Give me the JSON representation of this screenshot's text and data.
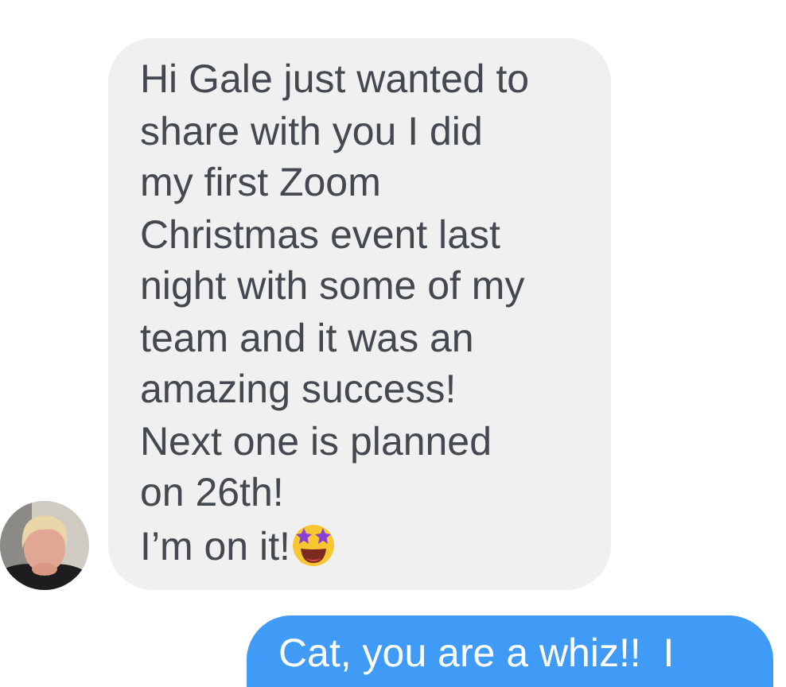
{
  "messages": [
    {
      "kind": "incoming",
      "text": "Hi Gale just wanted to\nshare with you I did\nmy first Zoom\nChristmas event last\nnight with some of my\nteam and it was an\namazing success!\nNext one is planned\non 26th!\nI’m on it!",
      "emoji": true
    },
    {
      "kind": "outgoing",
      "text": "Cat, you are a whiz!!  I",
      "emoji": false
    }
  ]
}
